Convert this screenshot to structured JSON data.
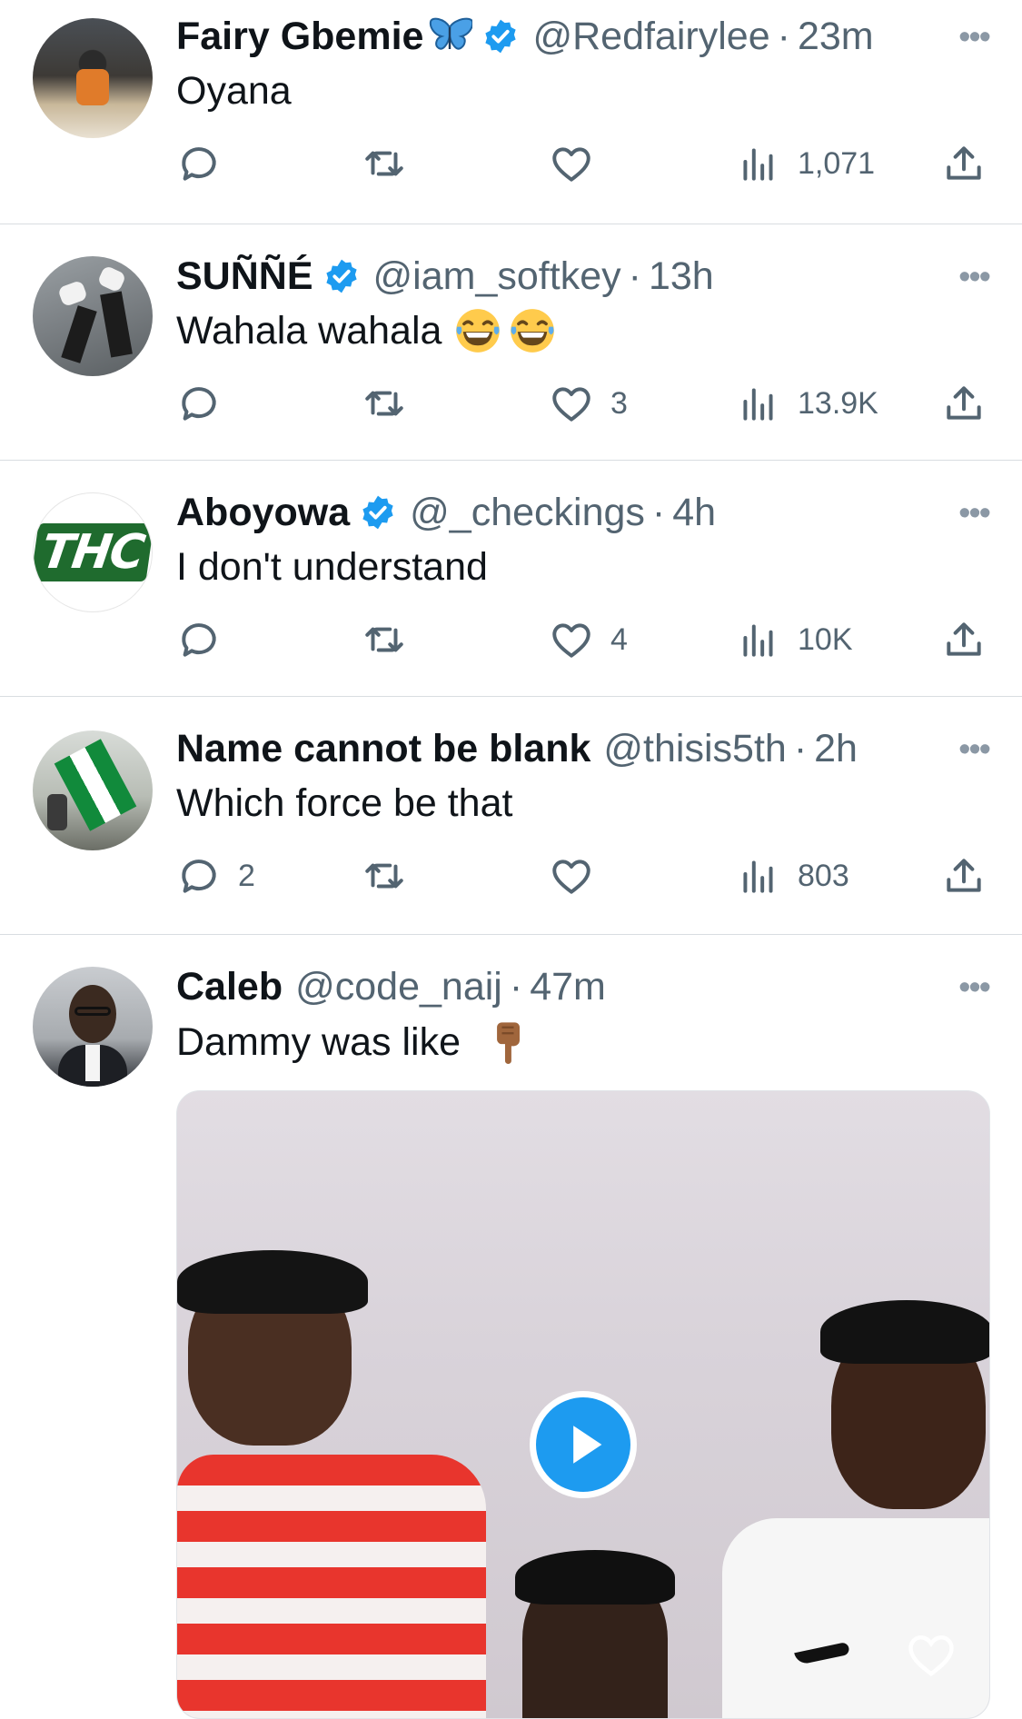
{
  "tweets": [
    {
      "name": "Fairy Gbemie",
      "handle": "@Redfairylee",
      "time": "23m",
      "text": "Oyana",
      "replies": "",
      "retweets": "",
      "likes": "",
      "views": "1,071"
    },
    {
      "name": "SUÑÑÉ",
      "handle": "@iam_softkey",
      "time": "13h",
      "text": "Wahala wahala",
      "replies": "",
      "retweets": "",
      "likes": "3",
      "views": "13.9K"
    },
    {
      "name": "Aboyowa",
      "handle": "@_checkings",
      "time": "4h",
      "text": "I don't understand",
      "avatar_text": "THC",
      "replies": "",
      "retweets": "",
      "likes": "4",
      "views": "10K"
    },
    {
      "name": "Name cannot be blank",
      "handle": "@thisis5th",
      "time": "2h",
      "text": "Which force be that",
      "replies": "2",
      "retweets": "",
      "likes": "",
      "views": "803"
    },
    {
      "name": "Caleb",
      "handle": "@code_naij",
      "time": "47m",
      "text": "Dammy was like"
    }
  ],
  "separator": "·",
  "more_label": "•••",
  "icons": [
    "reply-icon",
    "retweet-icon",
    "like-icon",
    "views-icon",
    "share-icon",
    "verified-badge-icon",
    "more-icon",
    "play-icon"
  ],
  "colors": {
    "verified": "#1d9bf0",
    "muted": "#536471",
    "play": "#1d9bf0",
    "thc_green": "#1f6b2e"
  }
}
